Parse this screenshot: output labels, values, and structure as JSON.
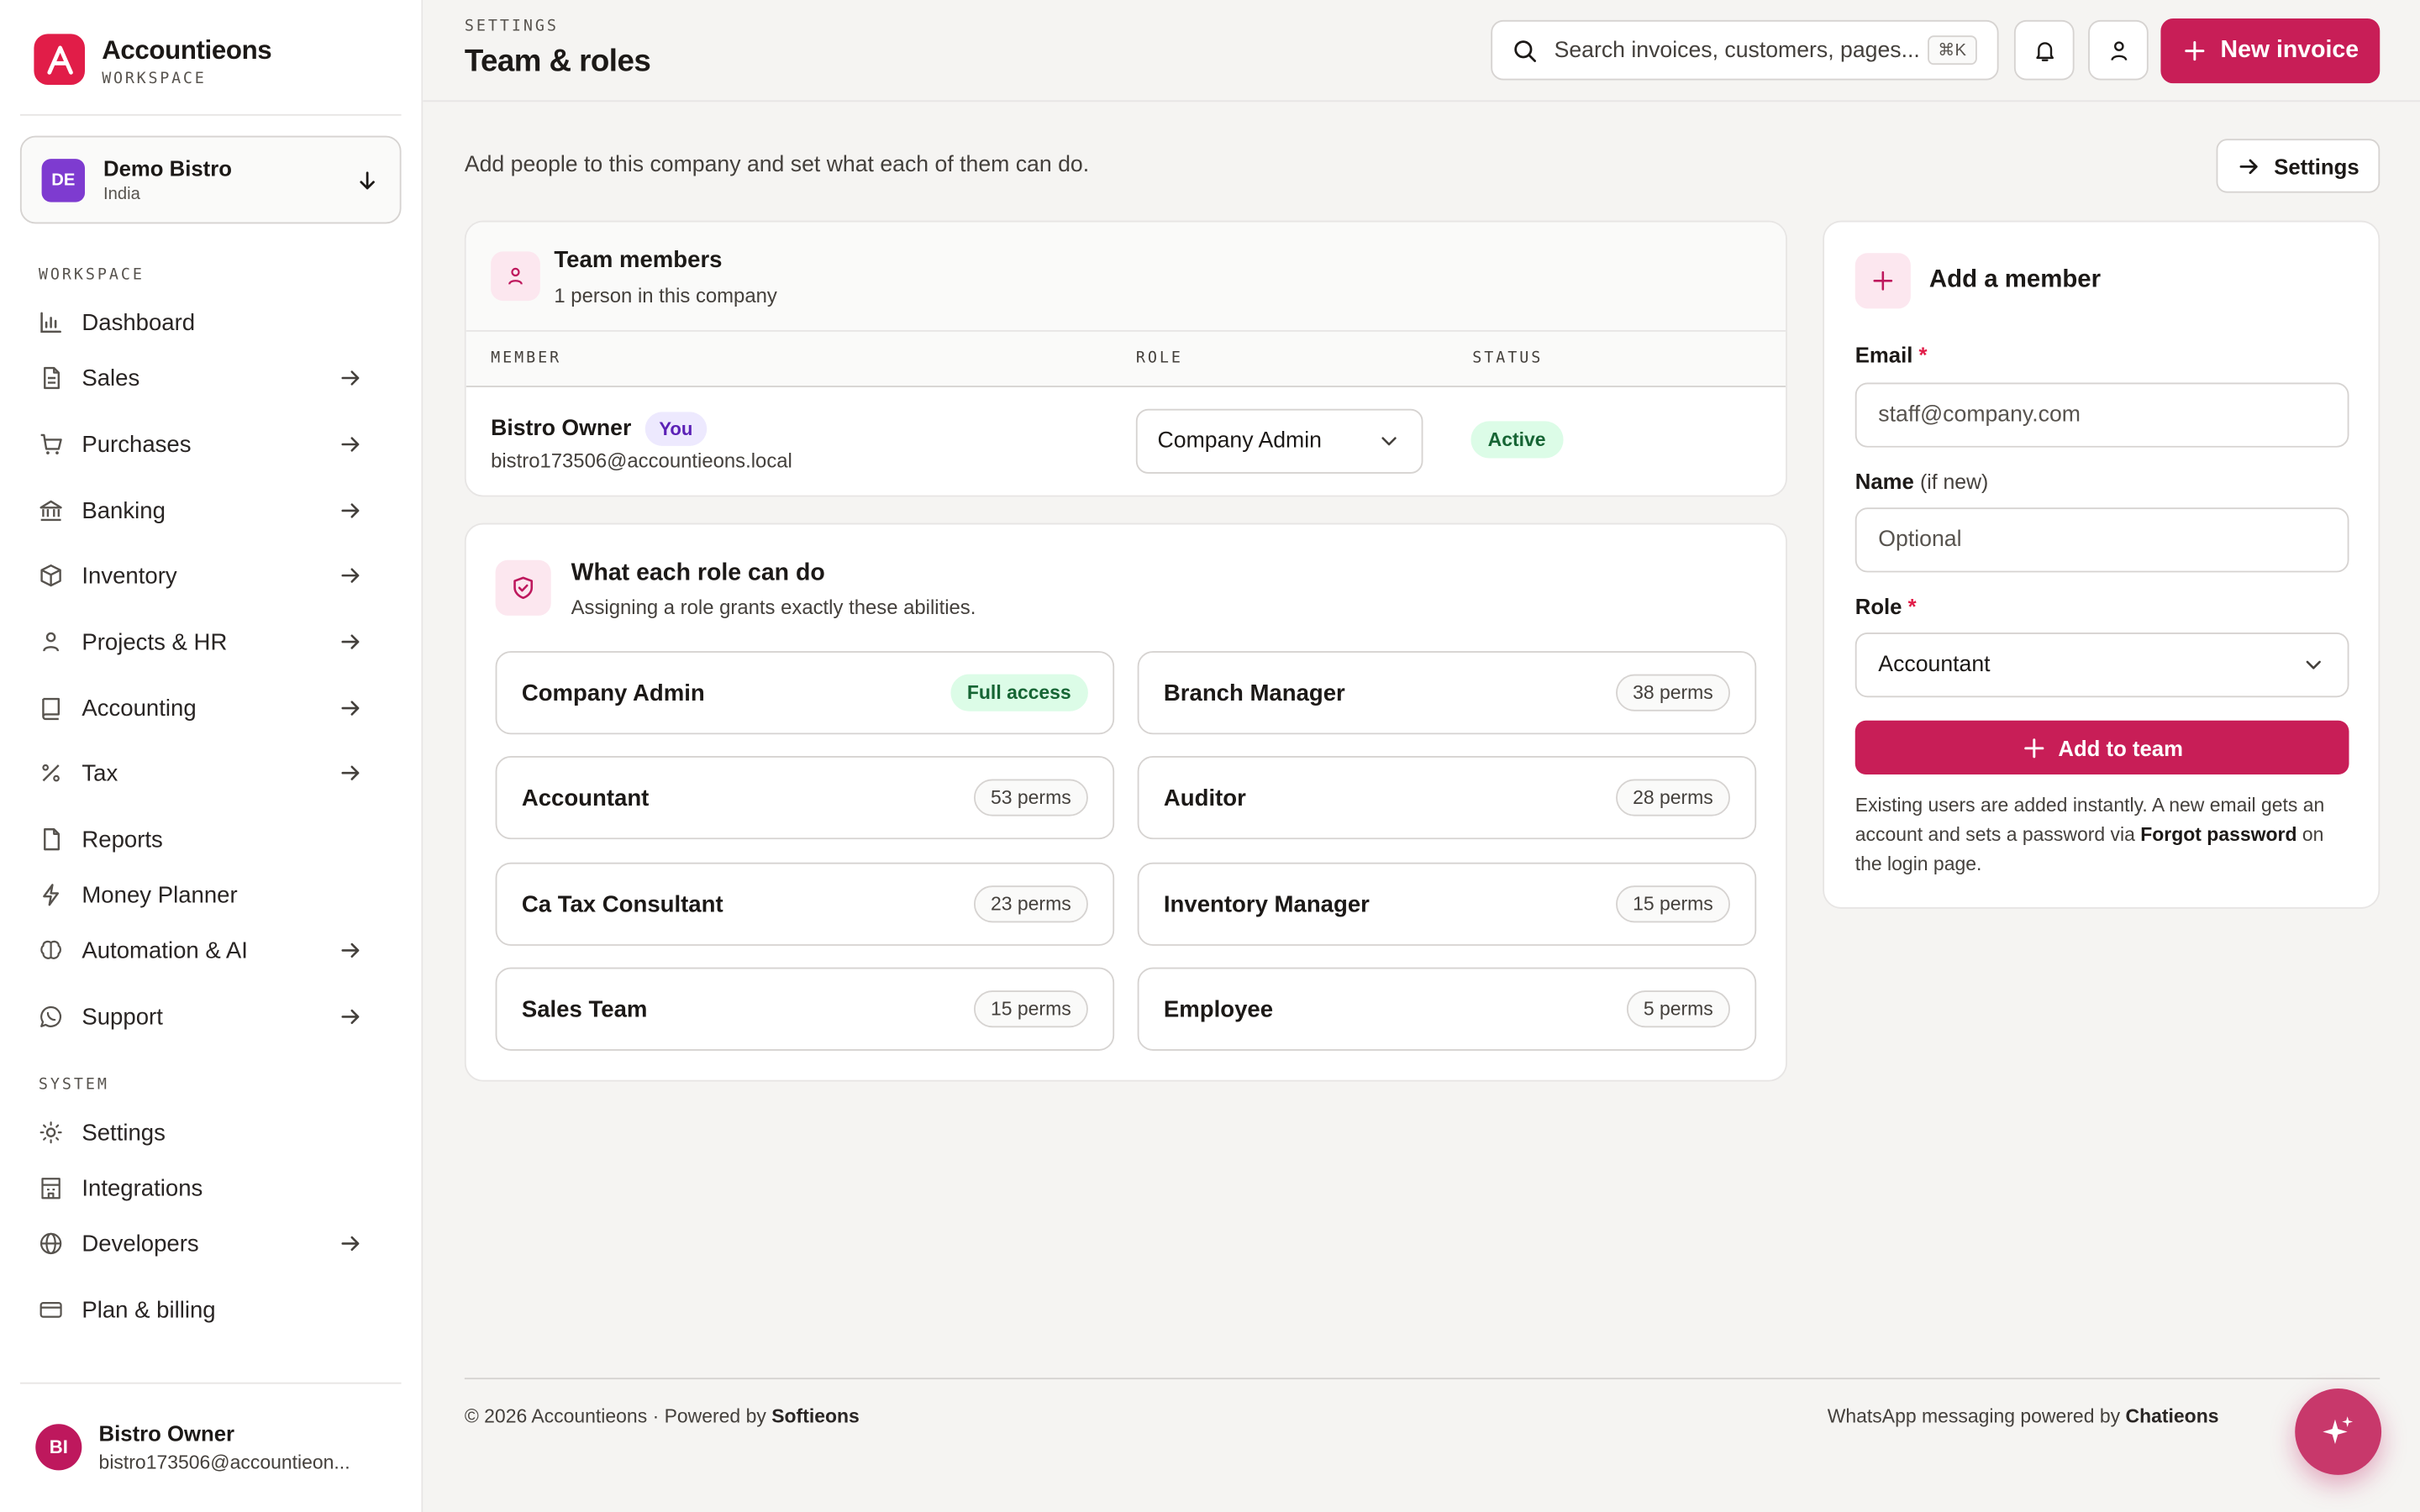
{
  "brand": {
    "name": "Accountieons",
    "sub": "WORKSPACE"
  },
  "company": {
    "initials": "DE",
    "name": "Demo Bistro",
    "country": "India"
  },
  "sidebar": {
    "workspace_label": "WORKSPACE",
    "system_label": "SYSTEM",
    "items": [
      {
        "label": "Dashboard",
        "icon": "chart-icon"
      },
      {
        "label": "Sales",
        "icon": "document-icon"
      },
      {
        "label": "Purchases",
        "icon": "cart-icon"
      },
      {
        "label": "Banking",
        "icon": "bank-icon"
      },
      {
        "label": "Inventory",
        "icon": "box-icon"
      },
      {
        "label": "Projects & HR",
        "icon": "person-icon"
      },
      {
        "label": "Accounting",
        "icon": "book-icon"
      },
      {
        "label": "Tax",
        "icon": "percent-icon"
      },
      {
        "label": "Reports",
        "icon": "file-icon"
      },
      {
        "label": "Money Planner",
        "icon": "bolt-icon"
      },
      {
        "label": "Automation & AI",
        "icon": "brain-icon"
      },
      {
        "label": "Support",
        "icon": "whatsapp-icon"
      }
    ],
    "system_items": [
      {
        "label": "Settings",
        "icon": "sun-icon"
      },
      {
        "label": "Integrations",
        "icon": "building-icon"
      },
      {
        "label": "Developers",
        "icon": "globe-icon"
      },
      {
        "label": "Plan & billing",
        "icon": "card-icon"
      }
    ]
  },
  "user": {
    "initials": "BI",
    "name": "Bistro Owner",
    "email": "bistro173506@accountieon..."
  },
  "header": {
    "breadcrumb": "SETTINGS",
    "title": "Team & roles",
    "search_placeholder": "Search invoices, customers, pages...",
    "search_shortcut": "⌘K",
    "new_invoice": "New invoice"
  },
  "intro": {
    "text": "Add people to this company and set what each of them can do.",
    "settings_button": "Settings"
  },
  "team": {
    "title": "Team members",
    "subtitle": "1 person in this company",
    "columns": [
      "MEMBER",
      "ROLE",
      "STATUS"
    ],
    "members": [
      {
        "name": "Bistro Owner",
        "badge": "You",
        "email": "bistro173506@accountieons.local",
        "role": "Company Admin",
        "status": "Active"
      }
    ]
  },
  "roles": {
    "title": "What each role can do",
    "subtitle": "Assigning a role grants exactly these abilities.",
    "items": [
      {
        "name": "Company Admin",
        "perms": "Full access"
      },
      {
        "name": "Branch Manager",
        "perms": "38 perms"
      },
      {
        "name": "Accountant",
        "perms": "53 perms"
      },
      {
        "name": "Auditor",
        "perms": "28 perms"
      },
      {
        "name": "Ca Tax Consultant",
        "perms": "23 perms"
      },
      {
        "name": "Inventory Manager",
        "perms": "15 perms"
      },
      {
        "name": "Sales Team",
        "perms": "15 perms"
      },
      {
        "name": "Employee",
        "perms": "5 perms"
      }
    ]
  },
  "add_member": {
    "title": "Add a member",
    "email_label": "Email",
    "email_placeholder": "staff@company.com",
    "name_label": "Name",
    "name_hint": "(if new)",
    "name_placeholder": "Optional",
    "role_label": "Role",
    "role_value": "Accountant",
    "button": "Add to team",
    "note_1": "Existing users are added instantly. A new email gets an account and sets a password via ",
    "note_bold": "Forgot password",
    "note_2": " on the login page."
  },
  "footer": {
    "left": "© 2026 Accountieons · Powered by ",
    "left_bold": "Softieons",
    "right": "WhatsApp messaging powered by ",
    "right_bold": "Chatieons"
  },
  "colors": {
    "accent": "#c81e57",
    "success": "#166534",
    "company_badge": "#7e3bd0"
  }
}
